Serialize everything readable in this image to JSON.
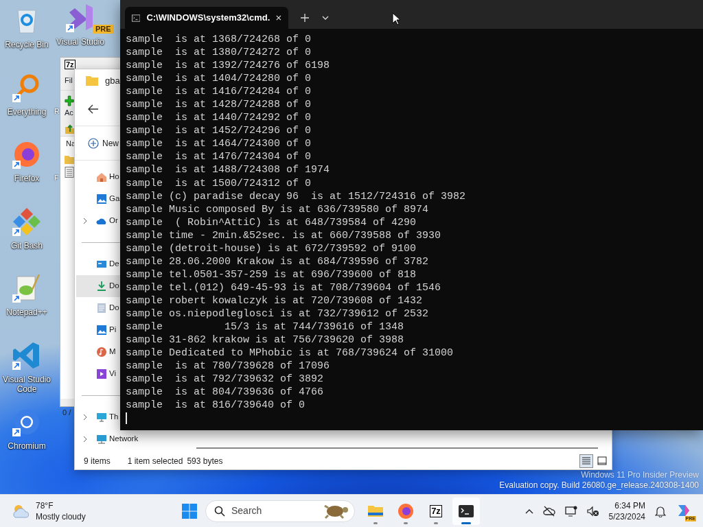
{
  "desktop_icons": [
    {
      "label": "Recycle Bin",
      "kind": "recycle",
      "shortcut": false
    },
    {
      "label": "Everything",
      "kind": "everything",
      "shortcut": true
    },
    {
      "label": "Firefox",
      "kind": "firefox",
      "shortcut": true
    },
    {
      "label": "Git Bash",
      "kind": "gitbash",
      "shortcut": true
    },
    {
      "label": "Notepad++",
      "kind": "notepad",
      "shortcut": true
    },
    {
      "label": "Visual Studio Code",
      "kind": "vscode",
      "shortcut": true
    },
    {
      "label": "Chromium",
      "kind": "chromium",
      "shortcut": true
    }
  ],
  "desktop_icons_column_2": [
    {
      "label": "Visual Studio",
      "kind": "visualstudio",
      "shortcut": true,
      "badge": "PRE"
    },
    {
      "label": "R"
    },
    {
      "label": "F"
    }
  ],
  "archive_window": {
    "logo": "7z",
    "menu": "Fil",
    "toolbar_button": "Ac",
    "column_header": "Na",
    "status": "0 /"
  },
  "explorer": {
    "tab": "gba",
    "new_button": "New",
    "nav_groups": [
      {
        "items": [
          {
            "label": "Ho",
            "kind": "home",
            "expandable": false,
            "selected": false
          },
          {
            "label": "Ga",
            "kind": "gallery",
            "expandable": false,
            "selected": false
          },
          {
            "label": "Or",
            "kind": "onedrive",
            "expandable": true,
            "selected": false
          }
        ]
      },
      {
        "items": [
          {
            "label": "De",
            "kind": "desktop",
            "expandable": false,
            "selected": false
          },
          {
            "label": "Do",
            "kind": "downloads",
            "expandable": false,
            "selected": true
          },
          {
            "label": "Do",
            "kind": "documents",
            "expandable": false,
            "selected": false
          },
          {
            "label": "Pi",
            "kind": "pictures",
            "expandable": false,
            "selected": false
          },
          {
            "label": "M",
            "kind": "music",
            "expandable": false,
            "selected": false
          },
          {
            "label": "Vi",
            "kind": "videos",
            "expandable": false,
            "selected": false
          }
        ]
      },
      {
        "items": [
          {
            "label": "Th",
            "kind": "thispc",
            "expandable": true,
            "selected": false
          },
          {
            "label": "Network",
            "kind": "network",
            "expandable": true,
            "selected": false
          }
        ]
      }
    ],
    "status": {
      "count": "9 items",
      "selection": "1 item selected",
      "size": "593 bytes"
    },
    "views": [
      {
        "kind": "details",
        "selected": true
      },
      {
        "kind": "tiles",
        "selected": false
      }
    ]
  },
  "terminal": {
    "tab_title": "C:\\WINDOWS\\system32\\cmd.",
    "lines": [
      "sample  is at 1368/724268 of 0",
      "sample  is at 1380/724272 of 0",
      "sample  is at 1392/724276 of 6198",
      "sample  is at 1404/724280 of 0",
      "sample  is at 1416/724284 of 0",
      "sample  is at 1428/724288 of 0",
      "sample  is at 1440/724292 of 0",
      "sample  is at 1452/724296 of 0",
      "sample  is at 1464/724300 of 0",
      "sample  is at 1476/724304 of 0",
      "sample  is at 1488/724308 of 1974",
      "sample  is at 1500/724312 of 0",
      "sample (c) paradise decay 96  is at 1512/724316 of 3982",
      "sample Music composed By is at 636/739580 of 8974",
      "sample  ( Robin^AttiC) is at 648/739584 of 4290",
      "sample time - 2min.&52sec. is at 660/739588 of 3930",
      "sample (detroit-house) is at 672/739592 of 9100",
      "sample 28.06.2000 Krakow is at 684/739596 of 3782",
      "sample tel.0501-357-259 is at 696/739600 of 818",
      "sample tel.(012) 649-45-93 is at 708/739604 of 1546",
      "sample robert kowalczyk is at 720/739608 of 1432",
      "sample os.niepodleglosci is at 732/739612 of 2532",
      "sample          15/3 is at 744/739616 of 1348",
      "sample 31-862 krakow is at 756/739620 of 3988",
      "sample Dedicated to MPhobic is at 768/739624 of 31000",
      "sample  is at 780/739628 of 17096",
      "sample  is at 792/739632 of 3892",
      "sample  is at 804/739636 of 4766",
      "sample  is at 816/739640 of 0"
    ]
  },
  "os_notice": [
    "Windows 11 Pro Insider Preview",
    "Evaluation copy. Build 26080.ge_release.240308-1400"
  ],
  "taskbar": {
    "weather": {
      "temperature": "78°F",
      "condition": "Mostly cloudy"
    },
    "search": {
      "placeholder": "Search"
    },
    "apps": [
      {
        "kind": "explorer",
        "selected": false
      },
      {
        "kind": "firefox",
        "selected": false
      },
      {
        "kind": "archiver",
        "label": "7z",
        "selected": false
      },
      {
        "kind": "terminal",
        "selected": true
      }
    ],
    "clock": {
      "time": "6:34 PM",
      "date": "5/23/2024"
    },
    "copilot_badge": "PRE"
  }
}
